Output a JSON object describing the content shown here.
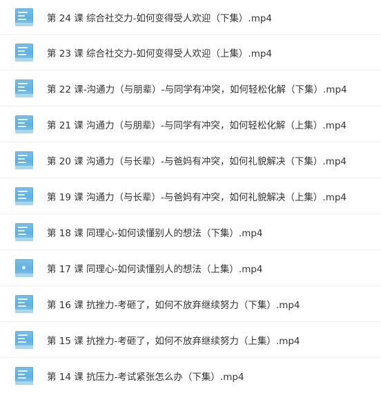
{
  "files": [
    {
      "name": "第 24 课 综合社交力-如何变得受人欢迎（下集）.mp4",
      "icon": "video-thumbnail-icon"
    },
    {
      "name": "第 23 课 综合社交力-如何变得受人欢迎（上集）.mp4",
      "icon": "video-thumbnail-icon"
    },
    {
      "name": "第 22 课-沟通力（与朋辈）-与同学有冲突，如何轻松化解（下集）.mp4",
      "icon": "video-thumbnail-icon"
    },
    {
      "name": "第 21 课 沟通力（与朋辈）-与同学有冲突，如何轻松化解（上集）.mp4",
      "icon": "video-thumbnail-icon"
    },
    {
      "name": "第 20 课 沟通力（与长辈）-与爸妈有冲突，如何礼貌解决（下集）.mp4",
      "icon": "video-thumbnail-icon"
    },
    {
      "name": "第 19 课 沟通力（与长辈）-与爸妈有冲突，如何礼貌解决（上集）.mp4",
      "icon": "video-thumbnail-icon"
    },
    {
      "name": "第 18 课 同理心-如何读懂别人的想法（下集）.mp4",
      "icon": "video-thumbnail-icon"
    },
    {
      "name": "第 17 课 同理心-如何读懂别人的想法（上集）.mp4",
      "icon": "video-thumbnail-plain-icon"
    },
    {
      "name": "第 16 课 抗挫力-考砸了，如何不放弃继续努力（下集）.mp4",
      "icon": "video-thumbnail-icon"
    },
    {
      "name": "第 15 课 抗挫力-考砸了，如何不放弃继续努力（上集）.mp4",
      "icon": "video-thumbnail-icon"
    },
    {
      "name": "第 14 课 抗压力-考试紧张怎么办（下集）.mp4",
      "icon": "video-thumbnail-icon"
    }
  ]
}
